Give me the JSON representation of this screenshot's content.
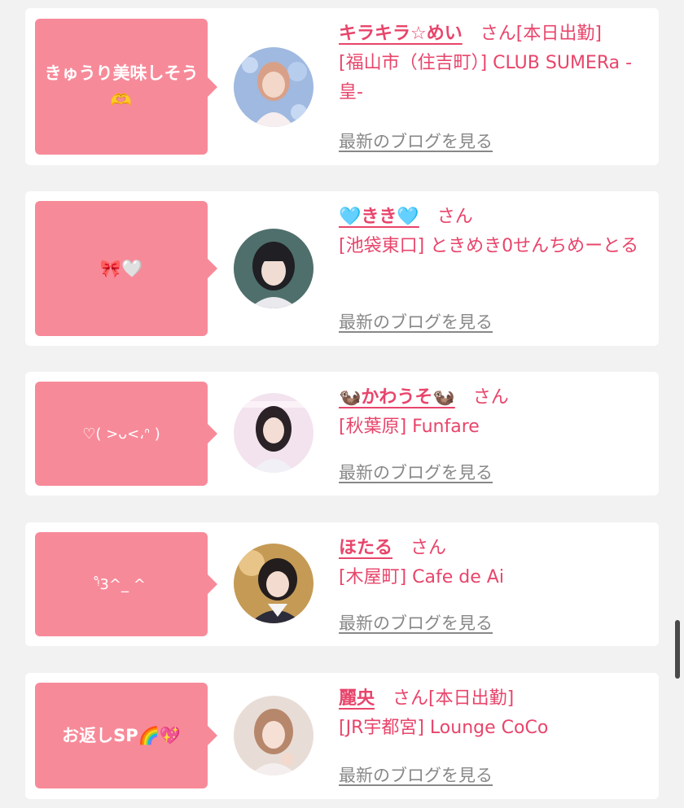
{
  "cards": [
    {
      "message": "きゅうり美味しそう🫶",
      "name": "キラキラ☆めい",
      "suffix": "さん[本日出勤]",
      "location": "[福山市（住吉町）] CLUB SUMERa -皇-",
      "blog_link": "最新のブログを見る"
    },
    {
      "message": "🎀🤍",
      "name": "🩵きき🩵",
      "suffix": "さん",
      "location": "[池袋東口] ときめき0せんちめーとる",
      "blog_link": "最新のブログを見る"
    },
    {
      "message": "♡( >ᴗ<،ᐢ )",
      "name": "🦦かわうそ🦦",
      "suffix": "さん",
      "location": "[秋葉原] Funfare",
      "blog_link": "最新のブログを見る"
    },
    {
      "message": "ᵎ̊3^_ ^",
      "name": "ほたる",
      "suffix": "さん",
      "location": "[木屋町] Cafe de Ai",
      "blog_link": "最新のブログを見る"
    },
    {
      "message": "お返しSP🌈💖",
      "name": "麗央",
      "suffix": "さん[本日出勤]",
      "location": "[JR宇都宮] Lounge CoCo",
      "blog_link": "最新のブログを見る"
    }
  ],
  "colors": {
    "accent": "#e8456b",
    "bubble": "#f78a99",
    "link_gray": "#888888"
  }
}
